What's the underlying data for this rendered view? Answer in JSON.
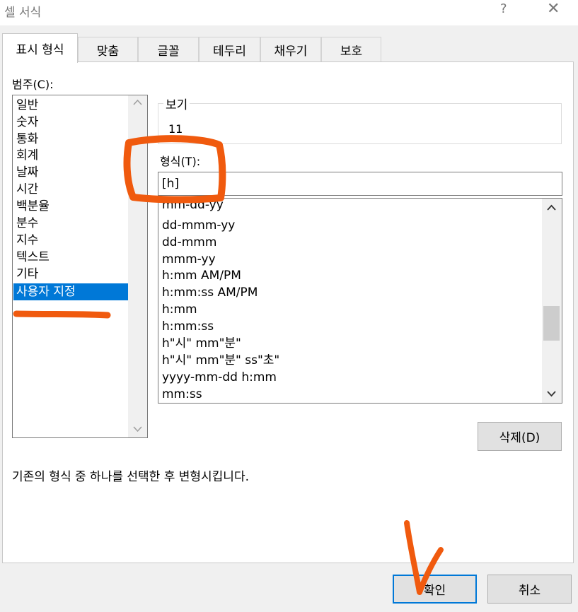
{
  "window": {
    "title": "셀 서식",
    "help_glyph": "?",
    "close_glyph": "✕"
  },
  "tabs": [
    {
      "label": "표시 형식",
      "active": true
    },
    {
      "label": "맞춤"
    },
    {
      "label": "글꼴"
    },
    {
      "label": "테두리"
    },
    {
      "label": "채우기"
    },
    {
      "label": "보호"
    }
  ],
  "category": {
    "label": "범주(C):",
    "items": [
      "일반",
      "숫자",
      "통화",
      "회계",
      "날짜",
      "시간",
      "백분율",
      "분수",
      "지수",
      "텍스트",
      "기타",
      "사용자 지정"
    ],
    "selected": "사용자 지정"
  },
  "sample": {
    "label": "보기",
    "value": "11"
  },
  "type": {
    "label": "형식(T):",
    "value": "[h]",
    "list": [
      "mm-dd-yy",
      "dd-mmm-yy",
      "dd-mmm",
      "mmm-yy",
      "h:mm AM/PM",
      "h:mm:ss AM/PM",
      "h:mm",
      "h:mm:ss",
      "h\"시\" mm\"분\"",
      "h\"시\" mm\"분\" ss\"초\"",
      "yyyy-mm-dd h:mm",
      "mm:ss"
    ]
  },
  "delete_label": "삭제(D)",
  "description": "기존의 형식 중 하나를 선택한 후 변형시킵니다.",
  "buttons": {
    "ok": "확인",
    "cancel": "취소"
  },
  "colors": {
    "selection": "#0078d7",
    "annotation": "#f05a0e",
    "accent_border": "#0078d7"
  },
  "icons": {
    "scroll_up": "chevron-up-icon",
    "scroll_down": "chevron-down-icon"
  }
}
